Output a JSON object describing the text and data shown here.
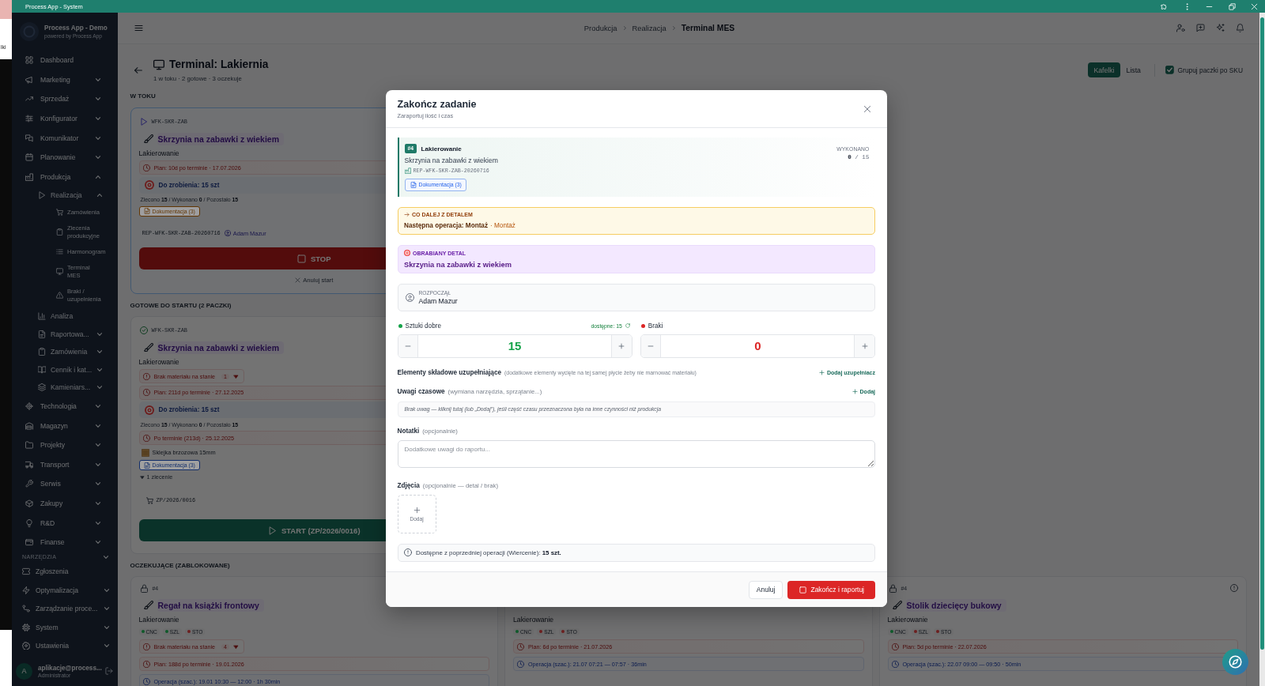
{
  "background_window": {
    "text": "lki"
  },
  "title_bar": {
    "title": "Process App - System"
  },
  "sidebar": {
    "brand": {
      "name": "Process App - Demo",
      "tagline": "powered by Process App"
    },
    "items": [
      {
        "label": "Dashboard",
        "kind": "link"
      },
      {
        "label": "Marketing",
        "kind": "group",
        "expanded": false
      },
      {
        "label": "Sprzedaż",
        "kind": "group",
        "expanded": false
      },
      {
        "label": "Konfigurator",
        "kind": "group",
        "expanded": false
      },
      {
        "label": "Komunikator",
        "kind": "group",
        "expanded": false
      },
      {
        "label": "Planowanie",
        "kind": "group",
        "expanded": false
      },
      {
        "label": "Produkcja",
        "kind": "group",
        "expanded": true,
        "children": [
          {
            "label": "Realizacja",
            "kind": "group",
            "expanded": true,
            "children": [
              {
                "label": "Zamówienia",
                "kind": "link"
              },
              {
                "label": "Zlecenia produkcyjne",
                "kind": "link"
              },
              {
                "label": "Harmonogram",
                "kind": "link"
              },
              {
                "label": "Terminal\nMES",
                "kind": "link"
              },
              {
                "label": "Braki / uzupełnienia",
                "kind": "link"
              }
            ]
          },
          {
            "label": "Analiza",
            "kind": "link"
          },
          {
            "label": "Raportowa...",
            "kind": "group",
            "expanded": false
          },
          {
            "label": "Zamówienia",
            "kind": "group",
            "expanded": false
          },
          {
            "label": "Cennik i kat...",
            "kind": "group",
            "expanded": false
          },
          {
            "label": "Kamieniars...",
            "kind": "group",
            "expanded": false
          }
        ]
      },
      {
        "label": "Technologia",
        "kind": "group",
        "expanded": false
      },
      {
        "label": "Magazyn",
        "kind": "group",
        "expanded": false
      },
      {
        "label": "Projekty",
        "kind": "group",
        "expanded": false
      },
      {
        "label": "Transport",
        "kind": "group",
        "expanded": false
      },
      {
        "label": "Serwis",
        "kind": "group",
        "expanded": false
      },
      {
        "label": "Zakupy",
        "kind": "group",
        "expanded": false
      },
      {
        "label": "R&D",
        "kind": "group",
        "expanded": false
      },
      {
        "label": "Finanse",
        "kind": "group",
        "expanded": false
      }
    ],
    "tools": {
      "heading": "NARZĘDZIA",
      "items": [
        {
          "label": "Zgłoszenia",
          "kind": "link"
        },
        {
          "label": "Optymalizacja",
          "kind": "group",
          "expanded": false
        },
        {
          "label": "Zarządzanie proce...",
          "kind": "group",
          "expanded": false
        },
        {
          "label": "System",
          "kind": "group",
          "expanded": false
        },
        {
          "label": "Ustawienia",
          "kind": "group",
          "expanded": false
        }
      ]
    },
    "user": {
      "initial": "A",
      "email": "aplikacje@process...",
      "role": "Administrator"
    }
  },
  "topbar": {
    "breadcrumbs": [
      "Produkcja",
      "Realizacja",
      "Terminal MES"
    ]
  },
  "page": {
    "title": "Terminal: Lakiernia",
    "subtitle": "1 w toku · 2 gotowe · 3 oczekuje",
    "view_modes": [
      {
        "label": "Kafelki",
        "selected": true
      },
      {
        "label": "Lista",
        "selected": false
      }
    ],
    "group_by_sku": {
      "label": "Grupuj paczki po SKU",
      "checked": true
    }
  },
  "sections": [
    {
      "kind": "in_progress",
      "heading": "W TOKU",
      "cards": [
        {
          "code": "WFK-SKR-ZAB",
          "title": "Skrzynia na zabawki z wiekiem",
          "operation": "Lakierowanie",
          "rows": [
            {
              "kind": "plan",
              "text": "Plan: 10d po terminie · 17.07.2026"
            },
            {
              "kind": "todo",
              "text": "Do zrobienia: 15 szt"
            },
            {
              "kind": "counts",
              "text": "Zlecono **15** / Wykonano **0** / Pozostało **15**"
            },
            {
              "kind": "docs",
              "text": "Dokumentacja (3)",
              "color": "#623603"
            },
            {
              "kind": "ref",
              "text": "REP-WFK-SKR-ZAB-20260716",
              "operator": "Adam Mazur"
            }
          ],
          "action": {
            "kind": "stop",
            "label": "STOP"
          },
          "cancel": "Anuluj start"
        }
      ]
    },
    {
      "kind": "ready",
      "heading": "GOTOWE DO STARTU (2 PACZKI)",
      "cards": [
        {
          "code": "WFK-SKR-ZAB",
          "title": "Skrzynia na zabawki z wiekiem",
          "operation": "Lakierowanie",
          "rows": [
            {
              "kind": "stock",
              "text": "Brak materiału na stanie",
              "count": "1"
            },
            {
              "kind": "plan",
              "text": "Plan: 211d po terminie · 27.12.2025"
            },
            {
              "kind": "todo",
              "text": "Do zrobienia: 15 szt"
            },
            {
              "kind": "counts",
              "text": "Zlecono **15** / Wykonano **0** / Pozostało **15**"
            },
            {
              "kind": "plan",
              "text": "Po terminie (213d) · 25.12.2025"
            },
            {
              "kind": "material",
              "text": "Sklejka brzozowa 15mm"
            },
            {
              "kind": "docs",
              "text": "Dokumentacja (3)",
              "color": "#112d6a"
            },
            {
              "kind": "orders",
              "label": "1 zlecenie",
              "expanded": true,
              "items": [
                "ZP/2026/0016"
              ]
            }
          ],
          "action": {
            "kind": "start",
            "label": "START (ZP/2026/0016)"
          }
        }
      ]
    },
    {
      "kind": "waiting",
      "heading": "OCZEKUJĄCE (ZABLOKOWANE)",
      "cards": [
        {
          "code": "#4",
          "title": "Regał na książki frontowy",
          "operation": "Lakierowanie",
          "tags": [
            {
              "label": "CNC",
              "color": "#0f592a"
            },
            {
              "label": "SZL",
              "color": "#0f592a"
            },
            {
              "label": "STO",
              "color": "#6c1f1f"
            }
          ],
          "rows": [
            {
              "kind": "stock",
              "text": "Brak materiału na stanie",
              "count": "4"
            },
            {
              "kind": "plan",
              "text": "Plan: 188d po terminie · 19.01.2026"
            },
            {
              "kind": "operation",
              "text": "Operacja (szac.): 19.01 10:30 — 12:00 · 1h 30min"
            }
          ]
        },
        {
          "operation": "Lakierowanie",
          "tags": [
            {
              "label": "CNC",
              "color": "#0f592a"
            },
            {
              "label": "SZL",
              "color": "#6c1f1f"
            },
            {
              "label": "STO",
              "color": "#6c1f1f"
            }
          ],
          "rows": [
            {
              "kind": "plan",
              "text": "Plan: 6d po terminie · 21.07.2026"
            },
            {
              "kind": "operation",
              "text": "Operacja (szac.): 21.07 07:21 — 07:57 · 36min"
            }
          ]
        },
        {
          "code": "#4",
          "title": "Stolik dziecięcy bukowy",
          "operation": "Lakierowanie",
          "details_button": true,
          "tags": [
            {
              "label": "CNC",
              "color": "#0f592a"
            },
            {
              "label": "SZL",
              "color": "#6c1f1f"
            },
            {
              "label": "STO",
              "color": "#6c1f1f"
            }
          ],
          "rows": [
            {
              "kind": "plan",
              "text": "Plan: 5d po terminie · 22.07.2026"
            },
            {
              "kind": "operation",
              "text": "Operacja (szac.): 22.07 09:00 — 09:50 · 50min"
            }
          ]
        }
      ]
    }
  ],
  "modal": {
    "title": "Zakończ zadanie",
    "subtitle": "Zaraportuj ilość i czas",
    "task": {
      "number": "#4",
      "operation": "Lakierowanie",
      "product": "Skrzynia na zabawki z wiekiem",
      "ref": "REP-WFK-SKR-ZAB-20260716",
      "docs": "Dokumentacja (3)",
      "done_label": "WYKONANO",
      "done": "**0** / 15"
    },
    "next_step": {
      "label": "CO DALEJ Z DETALEM",
      "operation": "Następna operacja: Montaż",
      "detail": "· Montaż"
    },
    "workpiece": {
      "label": "OBRABIANY DETAL",
      "name": "Skrzynia na zabawki z wiekiem"
    },
    "started_by": {
      "label": "ROZPOCZĄŁ",
      "name": "Adam Mazur"
    },
    "quantities": [
      {
        "label": "Sztuki dobre",
        "color": "#16a34a",
        "value": "15",
        "hint": "dostępne: 15"
      },
      {
        "label": "Braki",
        "color": "#dc2626",
        "value": "0"
      }
    ],
    "components": {
      "label": "Elementy składowe uzupełniające",
      "hint": "(dodatkowe elementy wycięte na tej samej płycie żeby nie marnować materiału)",
      "action": "Dodaj uzupełniacz"
    },
    "time_notes": {
      "label": "Uwagi czasowe",
      "hint": "(wymiana narzędzia, sprzątanie...)",
      "action": "Dodaj",
      "empty": "Brak uwag — kliknij tutaj (lub „Dodaj”), jeśli część czasu przeznaczona była na inne czynności niż produkcja"
    },
    "notes": {
      "label": "Notatki",
      "hint": "(opcjonalnie)",
      "placeholder": "Dodatkowe uwagi do raportu..."
    },
    "photos": {
      "label": "Zdjęcia",
      "hint": "(opcjonalnie — detal / brak)",
      "add": "Dodaj"
    },
    "available": "Dostępne z poprzedniej operacji (Wiercenie): **15 szt.**",
    "buttons": [
      {
        "label": "Anuluj",
        "kind": "secondary"
      },
      {
        "label": "Zakończ i raportuj",
        "kind": "primary"
      }
    ]
  }
}
